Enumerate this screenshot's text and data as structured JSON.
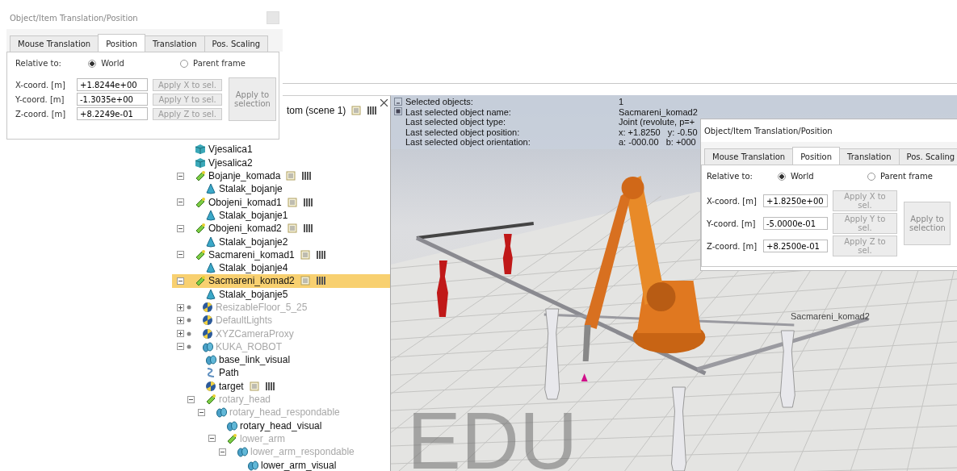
{
  "dialogs": [
    {
      "title": "Object/Item Translation/Position",
      "close_button": true,
      "tabs": [
        {
          "label": "Mouse Translation",
          "selected": false
        },
        {
          "label": "Position",
          "selected": true
        },
        {
          "label": "Translation",
          "selected": false
        },
        {
          "label": "Pos. Scaling",
          "selected": false
        }
      ],
      "relative_label": "Relative to:",
      "radios": [
        {
          "label": "World",
          "selected": true
        },
        {
          "label": "Parent frame",
          "selected": false
        }
      ],
      "coords": [
        {
          "label": "X-coord. [m]",
          "value": "+1.8244e+00",
          "apply": "Apply X to sel."
        },
        {
          "label": "Y-coord. [m]",
          "value": "-1.3035e+00",
          "apply": "Apply Y to sel."
        },
        {
          "label": "Z-coord. [m]",
          "value": "+8.2249e-01",
          "apply": "Apply Z to sel."
        }
      ],
      "apply_all": "Apply to selection"
    },
    {
      "title": "Object/Item Translation/Position",
      "close_button": false,
      "tabs": [
        {
          "label": "Mouse Translation",
          "selected": false
        },
        {
          "label": "Position",
          "selected": true
        },
        {
          "label": "Translation",
          "selected": false
        },
        {
          "label": "Pos. Scaling",
          "selected": false
        }
      ],
      "relative_label": "Relative to:",
      "radios": [
        {
          "label": "World",
          "selected": true
        },
        {
          "label": "Parent frame",
          "selected": false
        }
      ],
      "coords": [
        {
          "label": "X-coord. [m]",
          "value": "+1.8250e+00",
          "apply": "Apply X to sel."
        },
        {
          "label": "Y-coord. [m]",
          "value": "-5.0000e-01",
          "apply": "Apply Y to sel."
        },
        {
          "label": "Z-coord. [m]",
          "value": "+8.2500e-01",
          "apply": "Apply Z to sel."
        }
      ],
      "apply_all": "Apply to selection"
    }
  ],
  "scene_tree": {
    "scene_label": "tom (scene 1)",
    "scene_badges": true,
    "items": [
      {
        "label": "Vjesalica1",
        "kind": "cube",
        "dimmed": false,
        "badges": false,
        "model": false,
        "selected": false
      },
      {
        "label": "Vjesalica2",
        "kind": "cube",
        "dimmed": false,
        "badges": false,
        "model": false,
        "selected": false
      },
      {
        "label": "Bojanje_komada",
        "kind": "joint",
        "dimmed": false,
        "badges": true,
        "model": false,
        "selected": false,
        "expanded": true,
        "children": [
          {
            "label": "Stalak_bojanje",
            "kind": "cone",
            "dimmed": false,
            "badges": false,
            "model": false,
            "selected": false
          }
        ]
      },
      {
        "label": "Obojeni_komad1",
        "kind": "joint",
        "dimmed": false,
        "badges": true,
        "model": false,
        "selected": false,
        "expanded": true,
        "children": [
          {
            "label": "Stalak_bojanje1",
            "kind": "cone",
            "dimmed": false,
            "badges": false,
            "model": false,
            "selected": false
          }
        ]
      },
      {
        "label": "Obojeni_komad2",
        "kind": "joint",
        "dimmed": false,
        "badges": true,
        "model": false,
        "selected": false,
        "expanded": true,
        "children": [
          {
            "label": "Stalak_bojanje2",
            "kind": "cone",
            "dimmed": false,
            "badges": false,
            "model": false,
            "selected": false
          }
        ]
      },
      {
        "label": "Sacmareni_komad1",
        "kind": "joint",
        "dimmed": false,
        "badges": true,
        "model": false,
        "selected": false,
        "expanded": true,
        "children": [
          {
            "label": "Stalak_bojanje4",
            "kind": "cone",
            "dimmed": false,
            "badges": false,
            "model": false,
            "selected": false
          }
        ]
      },
      {
        "label": "Sacmareni_komad2",
        "kind": "joint",
        "dimmed": false,
        "badges": true,
        "model": false,
        "selected": true,
        "expanded": true,
        "children": [
          {
            "label": "Stalak_bojanje5",
            "kind": "cone",
            "dimmed": false,
            "badges": false,
            "model": false,
            "selected": false
          }
        ]
      },
      {
        "label": "ResizableFloor_5_25",
        "kind": "ball",
        "dimmed": true,
        "badges": false,
        "model": true,
        "selected": false,
        "expanded": false
      },
      {
        "label": "DefaultLights",
        "kind": "ball",
        "dimmed": true,
        "badges": false,
        "model": true,
        "selected": false,
        "expanded": false
      },
      {
        "label": "XYZCameraProxy",
        "kind": "ball",
        "dimmed": true,
        "badges": false,
        "model": true,
        "selected": false,
        "expanded": false
      },
      {
        "label": "KUKA_ROBOT",
        "kind": "shapes",
        "dimmed": true,
        "badges": false,
        "model": true,
        "selected": false,
        "expanded": true,
        "children": [
          {
            "label": "base_link_visual",
            "kind": "shapes",
            "dimmed": false,
            "badges": false,
            "model": false,
            "selected": false
          },
          {
            "label": "Path",
            "kind": "path",
            "dimmed": false,
            "badges": false,
            "model": false,
            "selected": false
          },
          {
            "label": "target",
            "kind": "ball",
            "dimmed": false,
            "badges": true,
            "model": false,
            "selected": false
          },
          {
            "label": "rotary_head",
            "kind": "joint",
            "dimmed": true,
            "badges": false,
            "model": false,
            "selected": false,
            "expanded": true,
            "children": [
              {
                "label": "rotary_head_respondable",
                "kind": "shapes",
                "dimmed": true,
                "badges": false,
                "model": false,
                "selected": false,
                "expanded": true,
                "children": [
                  {
                    "label": "rotary_head_visual",
                    "kind": "shapes",
                    "dimmed": false,
                    "badges": false,
                    "model": false,
                    "selected": false
                  },
                  {
                    "label": "lower_arm",
                    "kind": "joint",
                    "dimmed": true,
                    "badges": false,
                    "model": false,
                    "selected": false,
                    "expanded": true,
                    "children": [
                      {
                        "label": "lower_arm_respondable",
                        "kind": "shapes",
                        "dimmed": true,
                        "badges": false,
                        "model": false,
                        "selected": false,
                        "expanded": true,
                        "children": [
                          {
                            "label": "lower_arm_visual",
                            "kind": "shapes",
                            "dimmed": false,
                            "badges": false,
                            "model": false,
                            "selected": false
                          }
                        ]
                      }
                    ]
                  }
                ]
              }
            ]
          }
        ]
      }
    ]
  },
  "info_panel": {
    "rows": [
      {
        "label": "Selected objects:",
        "value": "1"
      },
      {
        "label": "Last selected object name:",
        "value": "Sacmareni_komad2"
      },
      {
        "label": "Last selected object type:",
        "value": "Joint (revolute, p=+"
      },
      {
        "label": "Last selected object position:",
        "value": "x: +1.8250   y: -0.50"
      },
      {
        "label": "Last selected object orientation:",
        "value": "a: -000.00   b: +000"
      }
    ]
  },
  "viewport": {
    "object_label": "Sacmareni_komad2",
    "watermark": "EDU"
  }
}
